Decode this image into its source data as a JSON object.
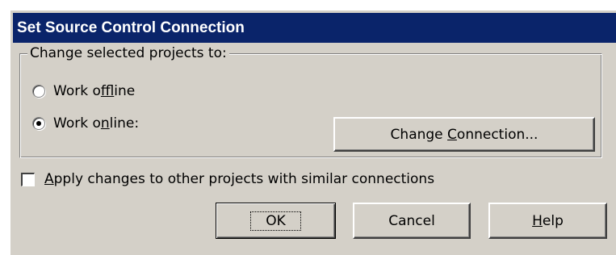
{
  "window": {
    "title": "Set Source Control Connection"
  },
  "group": {
    "legend": "Change selected projects to:"
  },
  "radios": {
    "offline": {
      "before": "Work o",
      "accel": "f",
      "after": "fline",
      "selected": false
    },
    "online": {
      "before": "Work o",
      "accel": "n",
      "after": "line:",
      "selected": true
    }
  },
  "change_connection": {
    "before": "Change ",
    "accel": "C",
    "after": "onnection..."
  },
  "apply_similar": {
    "accel": "A",
    "after": "pply changes to other projects with similar connections",
    "checked": false
  },
  "buttons": {
    "ok": "OK",
    "cancel": "Cancel",
    "help": {
      "accel": "H",
      "after": "elp"
    }
  },
  "colors": {
    "titlebar": "#0a246a",
    "face": "#d4d0c8"
  }
}
